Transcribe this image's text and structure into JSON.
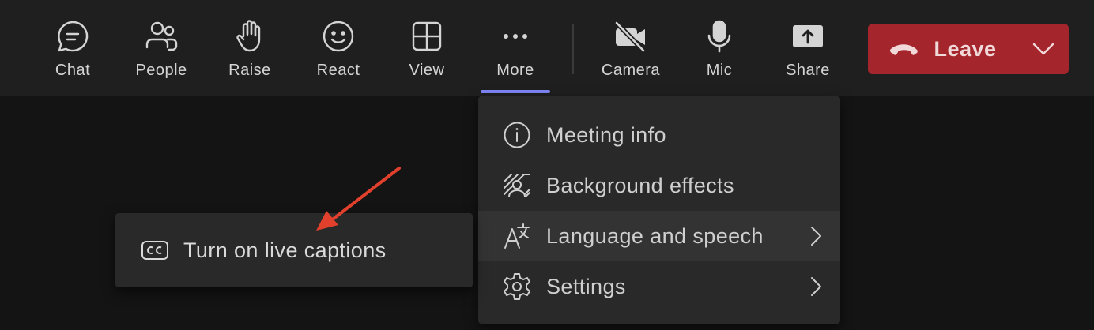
{
  "toolbar": {
    "buttons": [
      {
        "label": "Chat",
        "icon": "chat-icon"
      },
      {
        "label": "People",
        "icon": "people-icon"
      },
      {
        "label": "Raise",
        "icon": "raise-hand-icon"
      },
      {
        "label": "React",
        "icon": "smiley-icon"
      },
      {
        "label": "View",
        "icon": "grid-view-icon"
      },
      {
        "label": "More",
        "icon": "more-dots-icon"
      },
      {
        "label": "Camera",
        "icon": "camera-off-icon"
      },
      {
        "label": "Mic",
        "icon": "microphone-icon"
      },
      {
        "label": "Share",
        "icon": "share-tray-icon"
      }
    ],
    "active": "More",
    "leave_label": "Leave",
    "leave_color": "#a4262c",
    "accent_color": "#7f85f5"
  },
  "more_menu": {
    "items": [
      {
        "label": "Meeting info",
        "icon": "info-icon"
      },
      {
        "label": "Background effects",
        "icon": "background-effects-icon"
      },
      {
        "label": "Language and speech",
        "icon": "language-icon",
        "has_submenu": true
      },
      {
        "label": "Settings",
        "icon": "gear-icon",
        "has_submenu": true
      }
    ]
  },
  "submenu": {
    "items": [
      {
        "label": "Turn on live captions",
        "icon": "closed-captions-icon"
      }
    ]
  },
  "annotation": {
    "color": "#e0402c",
    "icon": "arrow-annotation-icon"
  }
}
